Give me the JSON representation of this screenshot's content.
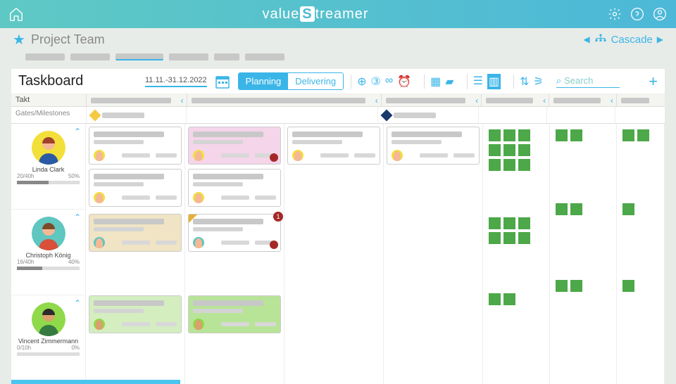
{
  "header": {
    "title_pre": "value",
    "title_mid": "S",
    "title_post": "treamer"
  },
  "subheader": {
    "title": "Project Team",
    "cascade": "Cascade"
  },
  "board": {
    "title": "Taskboard",
    "date_range": "11.11.-31.12.2022",
    "modes": {
      "planning": "Planning",
      "delivering": "Delivering"
    },
    "search_placeholder": "Search",
    "takt_label": "Takt",
    "gates_label": "Gates/Milestones"
  },
  "people": [
    {
      "name": "Linda Clark",
      "hours": "20/40h",
      "pct": "50%",
      "fill": 50,
      "bg": "#f3df3a",
      "skin": "#f5b896",
      "hair": "#a0412c",
      "shirt": "#2a5aa5"
    },
    {
      "name": "Christoph König",
      "hours": "16/40h",
      "pct": "40%",
      "fill": 40,
      "bg": "#5fc6c0",
      "skin": "#f5b896",
      "hair": "#7a4a2a",
      "shirt": "#d94f3a"
    },
    {
      "name": "Vincent Zimmermann",
      "hours": "0/10h",
      "pct": "0%",
      "fill": 0,
      "bg": "#8fd94a",
      "skin": "#dba06b",
      "hair": "#2c2c2c",
      "shirt": "#367a42"
    }
  ],
  "badge_count": "1"
}
